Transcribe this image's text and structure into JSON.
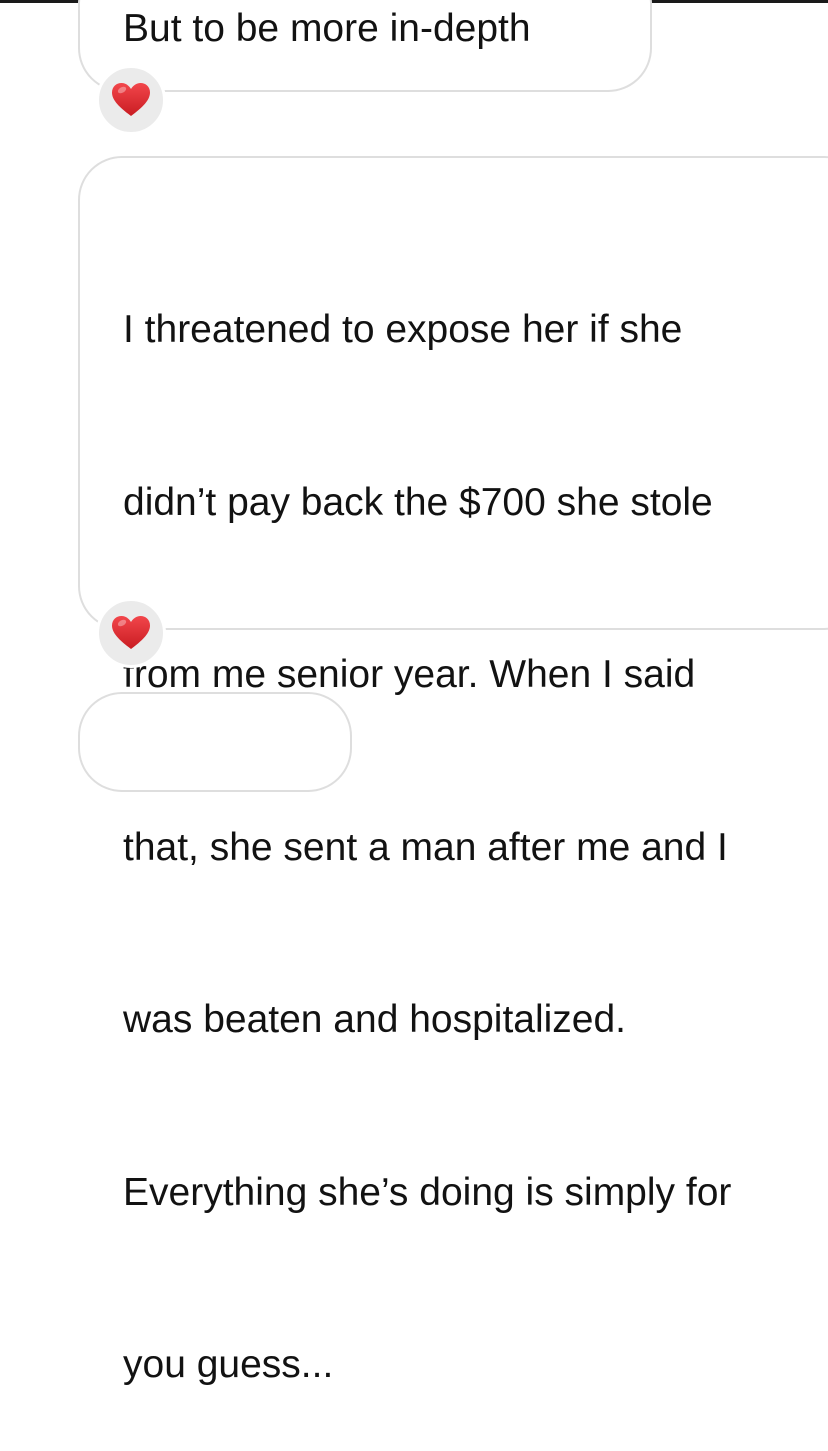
{
  "conversation": {
    "messages": [
      {
        "text": "But to be more in-depth",
        "reaction": "heart-icon"
      },
      {
        "lines": [
          "I threatened to expose her if she",
          "didn’t pay back the $700 she stole",
          "from me senior year. When I said",
          "that, she sent a man after me and I",
          "was beaten and hospitalized.",
          "Everything she’s doing is simply for",
          "you guess..."
        ],
        "reaction": "heart-icon"
      }
    ]
  },
  "colors": {
    "bubble_border": "#dedede",
    "reaction_bg": "#ebebeb",
    "heart": "#e0242a",
    "text": "#121212"
  }
}
